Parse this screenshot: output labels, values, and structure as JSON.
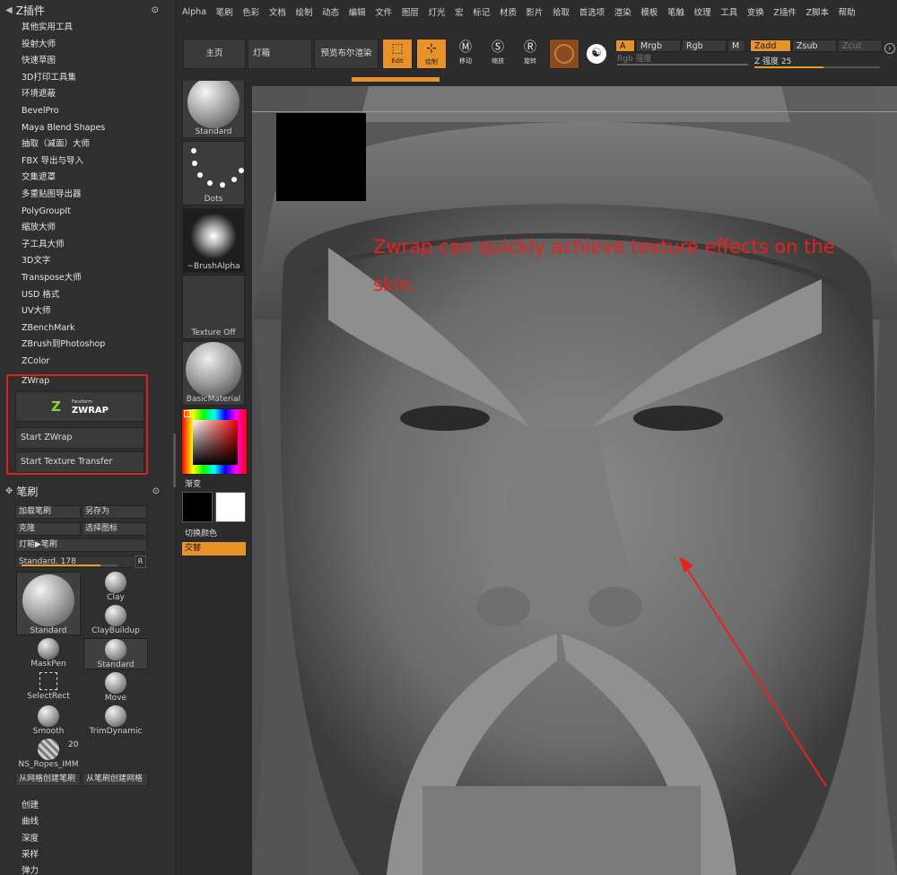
{
  "plugin_panel": {
    "title": "Z插件",
    "items": [
      "其他实用工具",
      "投射大师",
      "快速草图",
      "3D打印工具集",
      "环境遮蔽",
      "BevelPro",
      "Maya Blend Shapes",
      "抽取（减面）大师",
      "FBX 导出与导入",
      "交集遮罩",
      "多重贴图导出器",
      "PolyGroupIt",
      "缩放大师",
      "子工具大师",
      "3D文字",
      "Transpose大师",
      "USD 格式",
      "UV大师",
      "ZBenchMark",
      "ZBrush到Photoshop",
      "ZColor"
    ],
    "zwrap": {
      "title": "ZWrap",
      "logo_small": "Faceform",
      "logo_big": "ZWRAP",
      "start_zwrap": "Start ZWrap",
      "start_texture": "Start Texture Transfer"
    }
  },
  "brush_panel": {
    "title": "笔刷",
    "load": "加载笔刷",
    "save_as": "另存为",
    "clone": "克隆",
    "select_icon": "选择图标",
    "lightbox": "灯箱▶笔刷",
    "slider_label": "Standard. 178",
    "slider_value": 0.82,
    "r_button": "R",
    "brushes": [
      "Standard",
      "Clay",
      "ClayBuildup",
      "MaskPen",
      "Standard",
      "SelectRect",
      "Move",
      "Smooth",
      "TrimDynamic",
      "NS_Ropes_IMM"
    ],
    "count": "20",
    "from_mesh": "从网格创建笔刷",
    "from_brush": "从笔刷创建网格",
    "bottom_menu": [
      "创建",
      "曲线",
      "深度",
      "采样",
      "弹力"
    ]
  },
  "tray": {
    "standard": "Standard",
    "dots": "Dots",
    "alpha": "~BrushAlpha",
    "texture": "Texture Off",
    "material": "BasicMaterial",
    "gradient": "渐变",
    "switch_color": "切换颜色",
    "swap": "交替"
  },
  "menubar": [
    "Alpha",
    "笔刷",
    "色彩",
    "文档",
    "绘制",
    "动态",
    "编辑",
    "文件",
    "图层",
    "灯光",
    "宏",
    "标记",
    "材质",
    "影片",
    "拾取",
    "首选项",
    "渲染",
    "模板",
    "笔触",
    "纹理",
    "工具",
    "变换",
    "Z插件",
    "Z脚本",
    "帮助"
  ],
  "toolbar": {
    "home": "主页",
    "lightbox": "灯箱",
    "bpr": "预览布尔渲染",
    "edit": "Edit",
    "draw": "绘制",
    "move": "移动",
    "scale": "缩放",
    "rotate": "旋转",
    "a": "A",
    "mrgb": "Mrgb",
    "rgb": "Rgb",
    "m": "M",
    "zadd": "Zadd",
    "zsub": "Zsub",
    "zcut": "Zcut",
    "rgb_intensity": "Rgb 强度",
    "z_intensity": "Z 强度 25",
    "z_intensity_value": 0.55
  },
  "canvas": {
    "caption": "Zwrap can quickly achieve texture effects on the skin."
  },
  "colors": {
    "accent": "#e8922a",
    "annotation": "#e8211e",
    "zwrap_green": "#8fd13a"
  }
}
